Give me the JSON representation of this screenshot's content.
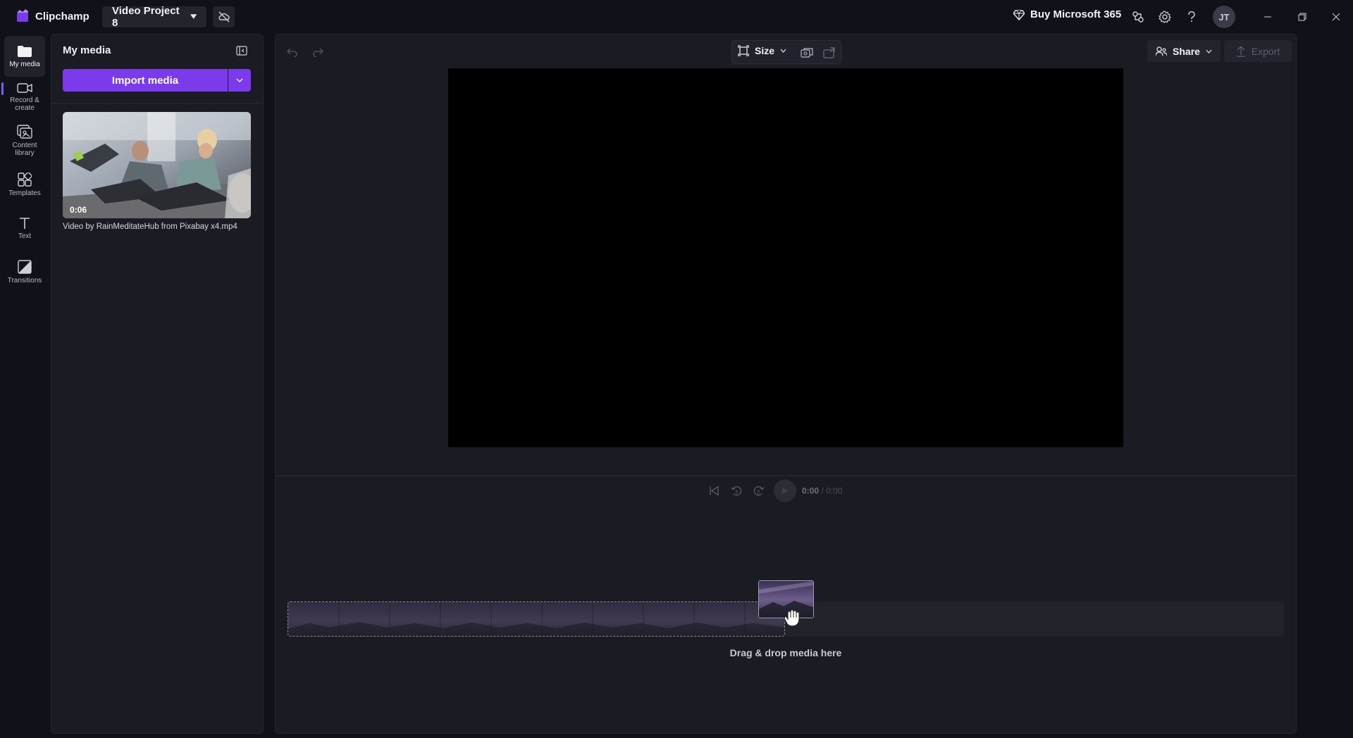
{
  "app": {
    "name": "Clipchamp",
    "project_name": "Video Project 8",
    "buy_label": "Buy Microsoft 365",
    "user_initials": "JT"
  },
  "rail": {
    "items": [
      {
        "label": "My media",
        "icon": "folder-icon",
        "active": true
      },
      {
        "label": "Record & create",
        "icon": "camera-icon"
      },
      {
        "label": "Content library",
        "icon": "library-icon"
      },
      {
        "label": "Templates",
        "icon": "templates-icon"
      },
      {
        "label": "Text",
        "icon": "text-icon"
      },
      {
        "label": "Transitions",
        "icon": "transitions-icon"
      }
    ]
  },
  "media_panel": {
    "title": "My media",
    "import_label": "Import media",
    "items": [
      {
        "filename": "Video by RainMeditateHub from Pixabay x4.mp4",
        "duration": "0:06"
      }
    ]
  },
  "editor": {
    "size_label": "Size",
    "share_label": "Share",
    "export_label": "Export",
    "time_current": "0:00",
    "time_separator": "/",
    "time_total": "0:00",
    "skip_back_seconds": "5",
    "skip_forward_seconds": "5",
    "drop_label": "Drag & drop media here"
  },
  "colors": {
    "accent": "#7c3aed",
    "background": "#111119",
    "panel": "#1b1b24"
  }
}
